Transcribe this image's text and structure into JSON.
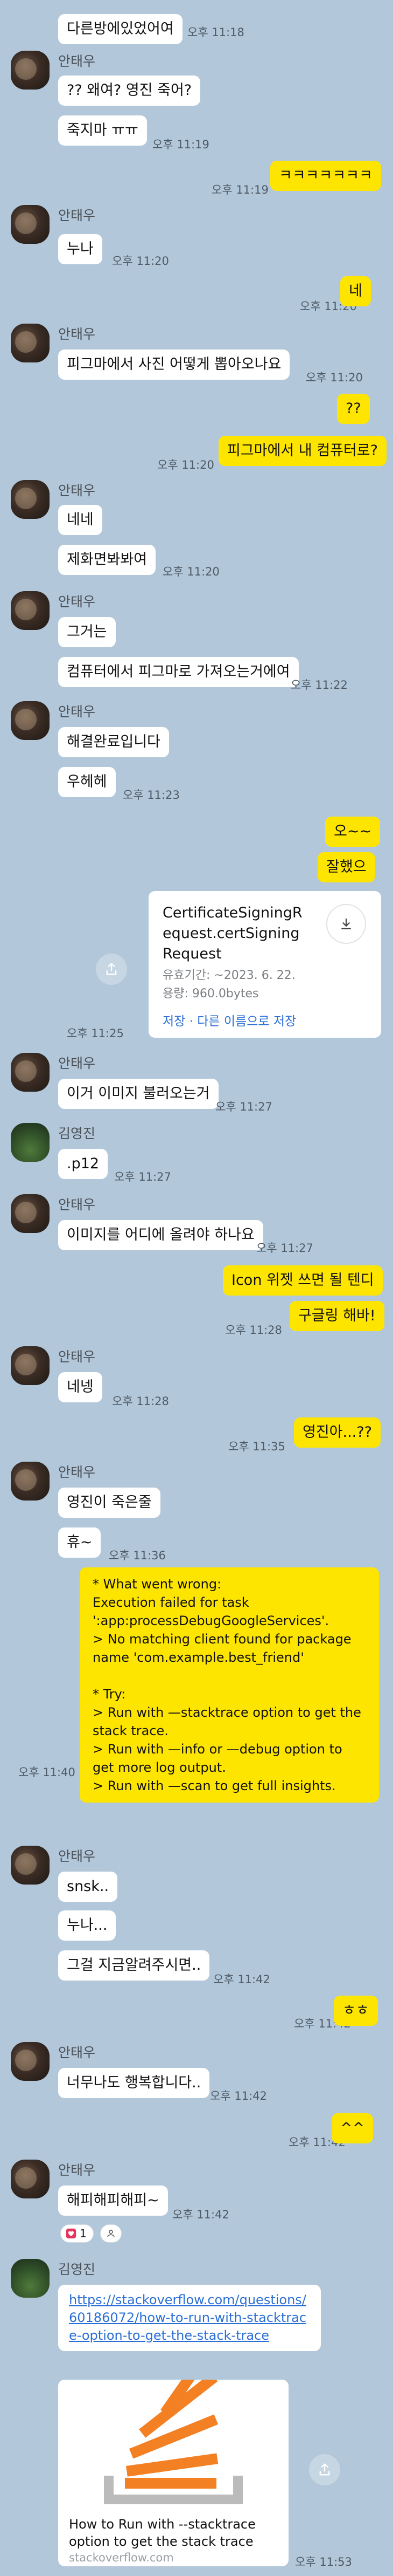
{
  "chat": {
    "msg_1": "다른방에있었어여",
    "time_1": "오후 11:18",
    "name_ahn": "안태우",
    "name_kim": "김영진",
    "msg_2": "?? 왜여? 영진 죽어?",
    "msg_3": "죽지마 ㅠㅠ",
    "time_3": "오후 11:19",
    "msg_4": "ㅋㅋㅋㅋㅋㅋㅋ",
    "time_4": "오후 11:19",
    "msg_5": "누나",
    "time_5": "오후 11:20",
    "msg_6": "네",
    "time_6": "오후 11:20",
    "msg_7": "피그마에서 사진 어떻게 뽑아오나요",
    "time_7": "오후 11:20",
    "msg_8": "??",
    "msg_9": "피그마에서 내 컴퓨터로?",
    "time_9": "오후 11:20",
    "msg_10": "네네",
    "msg_11": "제화면봐봐여",
    "time_11": "오후 11:20",
    "msg_12": "그거는",
    "msg_13": "컴퓨터에서 피그마로 가져오는거에여",
    "time_13": "오후 11:22",
    "msg_14": "해결완료입니다",
    "msg_15": "우헤헤",
    "time_15": "오후 11:23",
    "msg_16": "오~~",
    "msg_17": "잘했으",
    "file": {
      "name": "CertificateSigningRequest.certSigningRequest",
      "expiry": "유효기간: ~2023. 6. 22.",
      "size": "용량: 960.0bytes",
      "save": "저장",
      "save_as": "다른 이름으로 저장",
      "time": "오후 11:25"
    },
    "msg_18": "이거 이미지 불러오는거",
    "time_18": "오후 11:27",
    "msg_19": ".p12",
    "time_19": "오후 11:27",
    "msg_20": "이미지를 어디에 올려야 하나요",
    "time_20": "오후 11:27",
    "msg_21": "Icon 위젯 쓰면 될 텐디",
    "msg_22": "구글링 해바!",
    "time_22": "오후 11:28",
    "msg_23": "네넹",
    "time_23": "오후 11:28",
    "msg_24": "영진아...??",
    "time_24": "오후 11:35",
    "msg_25": "영진이 죽은줄",
    "msg_26": "휴~",
    "time_26": "오후 11:36",
    "error_lines": [
      "* What went wrong:",
      "Execution failed for task ':app:processDebugGoogleServices'.",
      "> No matching client found for package name 'com.example.best_friend'",
      "",
      "* Try:",
      "> Run with —stacktrace option to get the stack trace.",
      "> Run with —info or —debug option to get more log output.",
      "> Run with —scan to get full insights."
    ],
    "time_error": "오후 11:40",
    "msg_27": "snsk..",
    "msg_28": "누나...",
    "msg_29": "그걸 지금알려주시면..",
    "time_29": "오후 11:42",
    "msg_30": "ㅎㅎ",
    "time_30": "오후 11:42",
    "msg_31": "너무나도 행복합니다..",
    "time_31": "오후 11:42",
    "msg_32": "^^",
    "time_32": "오후 11:42",
    "msg_33": "해피해피해피~",
    "time_33": "오후 11:42",
    "reaction_count": "1",
    "link": {
      "url": "https://stackoverflow.com/questions/60186072/how-to-run-with-stacktrace-option-to-get-the-stack-trace",
      "title": "How to Run with --stacktrace option to get the stack trace",
      "domain": "stackoverflow.com",
      "time": "오후 11:53"
    }
  },
  "colors": {
    "background": "#b2c7d9",
    "my_bubble": "#fee500",
    "other_bubble": "#ffffff",
    "link": "#2a6fd6",
    "reaction_heart": "#e8335f"
  },
  "icons": [
    "share-icon",
    "download-icon",
    "heart-icon",
    "person-icon",
    "stackoverflow-logo"
  ]
}
